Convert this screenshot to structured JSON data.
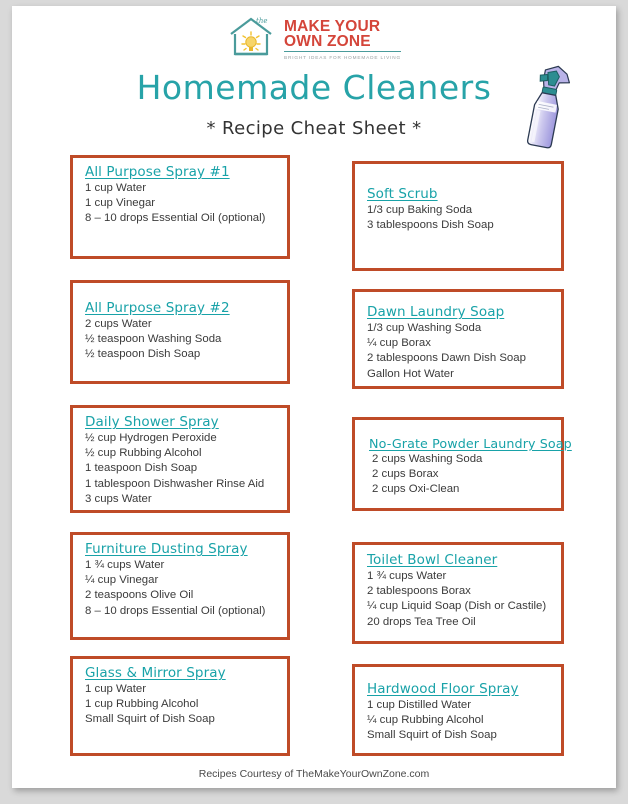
{
  "document": {
    "title": "Homemade Cleaners",
    "subtitle": "* Recipe Cheat Sheet *",
    "footer": "Recipes Courtesy of TheMakeYourOwnZone.com"
  },
  "logo": {
    "line1": "MAKE YOUR",
    "line2": "OWN ZONE",
    "tagline": "BRIGHT IDEAS FOR HOMEMADE LIVING",
    "the_word": "the",
    "brand_red": "#d4453a",
    "brand_teal": "#4a9b9b",
    "brand_yellow": "#f2c230"
  },
  "colors": {
    "title_teal": "#27a3a8",
    "heading_teal": "#18a2a8",
    "box_border": "#bf4b28",
    "body_text": "#3b3b3b",
    "page_bg": "#ffffff",
    "canvas_bg": "#d9d9d9",
    "bottle_body": "#a9a5e0",
    "bottle_trigger": "#2c8d91"
  },
  "recipes": {
    "left": [
      {
        "name": "All Purpose Spray #1",
        "ingredients": [
          "1 cup Water",
          "1 cup Vinegar",
          "8 – 10 drops Essential Oil (optional)"
        ]
      },
      {
        "name": "All Purpose Spray #2",
        "ingredients": [
          "2 cups Water",
          "½ teaspoon Washing Soda",
          "½ teaspoon Dish Soap"
        ]
      },
      {
        "name": "Daily Shower Spray",
        "ingredients": [
          "½ cup Hydrogen Peroxide",
          "½ cup Rubbing Alcohol",
          "1 teaspoon Dish Soap",
          "1 tablespoon Dishwasher Rinse Aid",
          "3 cups Water"
        ]
      },
      {
        "name": "Furniture Dusting Spray",
        "ingredients": [
          "1 ¾ cups Water",
          "¼ cup Vinegar",
          "2 teaspoons Olive Oil",
          "8 – 10 drops Essential Oil (optional)"
        ]
      },
      {
        "name": "Glass & Mirror Spray",
        "ingredients": [
          "1 cup Water",
          "1 cup Rubbing Alcohol",
          "Small Squirt of Dish Soap"
        ]
      }
    ],
    "right": [
      {
        "name": "Soft Scrub",
        "ingredients": [
          "1/3 cup Baking Soda",
          "3 tablespoons Dish Soap"
        ]
      },
      {
        "name": "Dawn Laundry Soap",
        "ingredients": [
          "1/3 cup Washing Soda",
          "¼ cup Borax",
          "2 tablespoons Dawn Dish Soap",
          "Gallon Hot Water"
        ]
      },
      {
        "name": "No-Grate Powder Laundry Soap",
        "ingredients": [
          "2 cups Washing Soda",
          "2 cups Borax",
          "2 cups Oxi-Clean"
        ]
      },
      {
        "name": "Toilet Bowl Cleaner",
        "ingredients": [
          "1 ¾ cups Water",
          "2 tablespoons Borax",
          "¼ cup Liquid Soap (Dish or Castile)",
          "20 drops Tea Tree Oil"
        ]
      },
      {
        "name": "Hardwood Floor Spray",
        "ingredients": [
          "1 cup Distilled Water",
          "¼ cup Rubbing Alcohol",
          "Small Squirt of Dish Soap"
        ]
      }
    ]
  }
}
